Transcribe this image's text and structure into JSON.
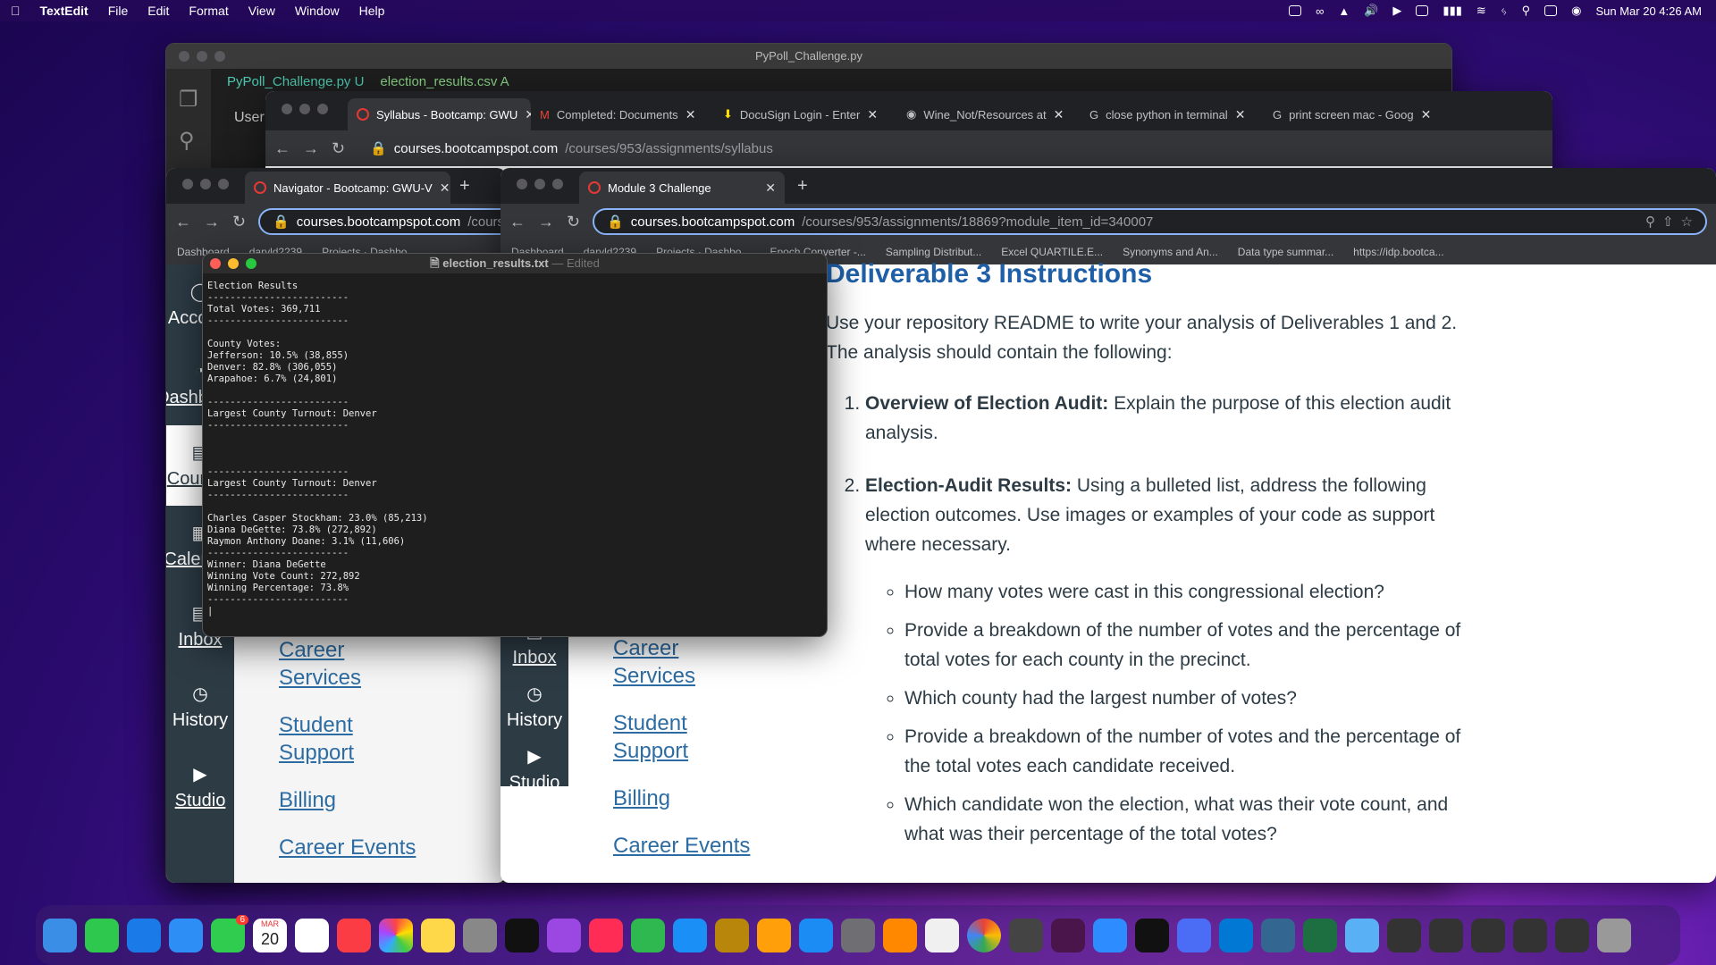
{
  "menubar": {
    "apple": "",
    "app": "TextEdit",
    "items": [
      "File",
      "Edit",
      "Format",
      "View",
      "Window",
      "Help"
    ],
    "datetime": "Sun Mar 20  4:26 AM"
  },
  "vscode": {
    "title": "PyPoll_Challenge.py",
    "tab1": "PyPoll_Challenge.py U",
    "tab2": "election_results.csv A",
    "user": "User"
  },
  "chrome_back": {
    "tabs": [
      "Syllabus - Bootcamp: GWU",
      "Completed: Documents",
      "DocuSign Login - Enter",
      "Wine_Not/Resources at",
      "close python in terminal",
      "print screen mac - Goog"
    ],
    "url_domain": "courses.bootcampspot.com",
    "url_path": "/courses/953/assignments/syllabus"
  },
  "chrome_left": {
    "tab": "Navigator - Bootcamp: GWU-V",
    "url_domain": "courses.bootcampspot.com",
    "url_path": "/course",
    "bookmarks": [
      "Dashboard",
      "daryld2239",
      "Projects · Dashbo"
    ]
  },
  "chrome_main": {
    "tab": "Module 3 Challenge",
    "url_domain": "courses.bootcampspot.com",
    "url_path": "/courses/953/assignments/18869?module_item_id=340007",
    "bookmarks": [
      "Dashboard",
      "daryld2239",
      "Projects · Dashbo...",
      "Epoch Converter -...",
      "Sampling Distribut...",
      "Excel QUARTILE.E...",
      "Synonyms and An...",
      "Data type summar...",
      "https://idp.bootca..."
    ]
  },
  "canvas_nav": {
    "items": [
      "Account",
      "Dashboard",
      "Courses",
      "Calendar",
      "Inbox",
      "History",
      "Studio"
    ]
  },
  "canvas_links": [
    "Career Services",
    "Student Support",
    "Billing",
    "Career Events"
  ],
  "textedit": {
    "filename": "election_results.txt",
    "status": "— Edited",
    "body": "Election Results\n-------------------------\nTotal Votes: 369,711\n-------------------------\n\nCounty Votes:\nJefferson: 10.5% (38,855)\nDenver: 82.8% (306,055)\nArapahoe: 6.7% (24,801)\n\n-------------------------\nLargest County Turnout: Denver\n-------------------------\n\n\n\n-------------------------\nLargest County Turnout: Denver\n-------------------------\n\nCharles Casper Stockham: 23.0% (85,213)\nDiana DeGette: 73.8% (272,892)\nRaymon Anthony Doane: 3.1% (11,606)\n-------------------------\nWinner: Diana DeGette\nWinning Vote Count: 272,892\nWinning Percentage: 73.8%\n-------------------------\n|"
  },
  "content": {
    "heading": "Deliverable 3 Instructions",
    "intro": "Use your repository README to write your analysis of Deliverables 1 and 2. The analysis should contain the following:",
    "item1_bold": "Overview of Election Audit:",
    "item1_text": " Explain the purpose of this election audit analysis.",
    "item2_bold": "Election-Audit Results:",
    "item2_text": " Using a bulleted list, address the following election outcomes. Use images or examples of your code as support where necessary.",
    "bullets": [
      "How many votes were cast in this congressional election?",
      "Provide a breakdown of the number of votes and the percentage of total votes for each county in the precinct.",
      "Which county had the largest number of votes?",
      "Provide a breakdown of the number of votes and the percentage of the total votes each candidate received.",
      "Which candidate won the election, what was their vote count, and what was their percentage of the total votes?"
    ]
  },
  "dock": {
    "calendar_month": "MAR",
    "calendar_day": "20",
    "messages_badge": "6"
  }
}
